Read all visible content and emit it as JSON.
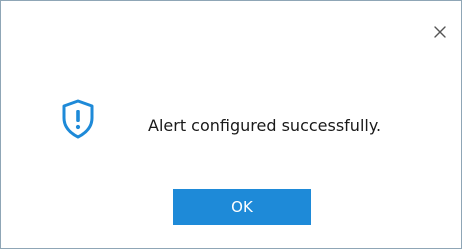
{
  "dialog": {
    "message": "Alert configured successfully.",
    "ok_label": "OK",
    "icon": "shield-exclamation-icon",
    "close_icon": "close-icon"
  },
  "colors": {
    "accent": "#1e8ad8",
    "border": "#8fa6b6",
    "text": "#1a1a1a",
    "icon_close": "#555555"
  }
}
